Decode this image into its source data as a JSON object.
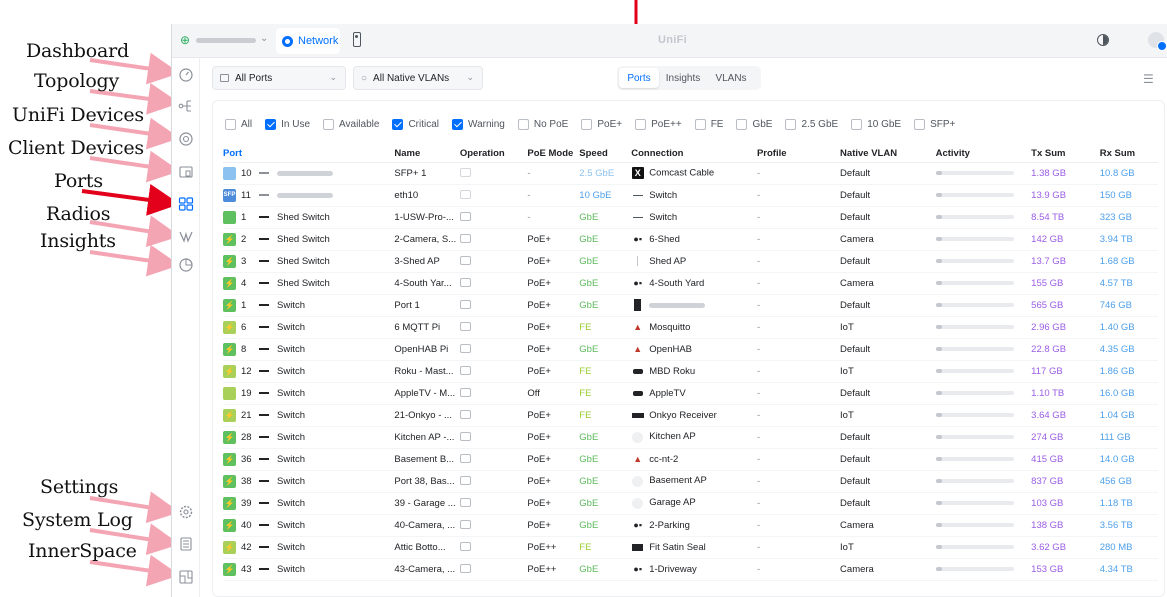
{
  "annotations": [
    {
      "label": "Dashboard"
    },
    {
      "label": "Topology"
    },
    {
      "label": "UniFi Devices"
    },
    {
      "label": "Client Devices"
    },
    {
      "label": "Ports"
    },
    {
      "label": "Radios"
    },
    {
      "label": "Insights"
    },
    {
      "label": "Settings"
    },
    {
      "label": "System Log"
    },
    {
      "label": "InnerSpace"
    }
  ],
  "colors": {
    "accent": "#006fff",
    "annotation_arrow": "#f4a5b4",
    "annotation_arrow_active": "#e3001b",
    "tx": "#9b5de5",
    "rx": "#4d9fea"
  },
  "topbar": {
    "app_tab": "Network",
    "brand": "UniFi"
  },
  "sidebar": {
    "items": [
      {
        "name": "dashboard",
        "icon": "speedometer-icon"
      },
      {
        "name": "topology",
        "icon": "topology-icon"
      },
      {
        "name": "unifi-devices",
        "icon": "device-icon"
      },
      {
        "name": "client-devices",
        "icon": "clients-icon"
      },
      {
        "name": "ports",
        "icon": "ports-icon",
        "active": true
      },
      {
        "name": "radios",
        "icon": "radio-icon"
      },
      {
        "name": "insights",
        "icon": "insights-icon"
      },
      {
        "name": "settings",
        "icon": "gear-icon"
      },
      {
        "name": "system-log",
        "icon": "log-icon"
      },
      {
        "name": "innerspace",
        "icon": "floorplan-icon"
      }
    ]
  },
  "filters": {
    "ports_select": "All Ports",
    "vlan_select": "All Native VLANs"
  },
  "view_tabs": [
    {
      "label": "Ports",
      "active": true
    },
    {
      "label": "Insights",
      "active": false
    },
    {
      "label": "VLANs",
      "active": false
    }
  ],
  "chips": [
    {
      "label": "All",
      "checked": false
    },
    {
      "label": "In Use",
      "checked": true
    },
    {
      "label": "Available",
      "checked": false
    },
    {
      "label": "Critical",
      "checked": true
    },
    {
      "label": "Warning",
      "checked": true
    },
    {
      "label": "No PoE",
      "checked": false
    },
    {
      "label": "PoE+",
      "checked": false
    },
    {
      "label": "PoE++",
      "checked": false
    },
    {
      "label": "FE",
      "checked": false
    },
    {
      "label": "GbE",
      "checked": false
    },
    {
      "label": "2.5 GbE",
      "checked": false
    },
    {
      "label": "10 GbE",
      "checked": false
    },
    {
      "label": "SFP+",
      "checked": false
    }
  ],
  "table": {
    "columns": [
      "Port",
      "Name",
      "Operation",
      "PoE Mode",
      "Speed",
      "Connection",
      "Profile",
      "Native VLAN",
      "Activity",
      "Tx Sum",
      "Rx Sum"
    ],
    "rows": [
      {
        "port": "10",
        "badge": "blue",
        "device": "",
        "name": "SFP+ 1",
        "poe": "-",
        "speed": "2.5 GbE",
        "speed_color": "gray",
        "conn_icon": "none",
        "connection": "Comcast Cable",
        "profile": "-",
        "vlan": "Default",
        "tx": "1.38 GB",
        "rx": "10.8 GB"
      },
      {
        "port": "11",
        "badge": "sfp",
        "device": "",
        "name": "eth10",
        "poe": "-",
        "speed": "10 GbE",
        "speed_color": "blue",
        "conn_icon": "dash",
        "connection": "Switch",
        "profile": "-",
        "vlan": "Default",
        "tx": "13.9 GB",
        "rx": "150 GB"
      },
      {
        "port": "1",
        "badge": "green-plain",
        "device": "Shed Switch",
        "name": "1-USW-Pro-...",
        "poe": "-",
        "speed": "GbE",
        "speed_color": "green",
        "conn_icon": "dash",
        "connection": "Switch",
        "profile": "-",
        "vlan": "Default",
        "tx": "8.54 TB",
        "rx": "323 GB"
      },
      {
        "port": "2",
        "badge": "green",
        "device": "Shed Switch",
        "name": "2-Camera, S...",
        "poe": "PoE+",
        "speed": "GbE",
        "speed_color": "green",
        "conn_icon": "camera",
        "connection": "6-Shed",
        "profile": "-",
        "vlan": "Camera",
        "tx": "142 GB",
        "rx": "3.94 TB"
      },
      {
        "port": "3",
        "badge": "green",
        "device": "Shed Switch",
        "name": "3-Shed AP",
        "poe": "PoE+",
        "speed": "GbE",
        "speed_color": "green",
        "conn_icon": "ap-bar",
        "connection": "Shed AP",
        "profile": "-",
        "vlan": "Default",
        "tx": "13.7 GB",
        "rx": "1.68 GB"
      },
      {
        "port": "4",
        "badge": "green",
        "device": "Shed Switch",
        "name": "4-South Yar...",
        "poe": "PoE+",
        "speed": "GbE",
        "speed_color": "green",
        "conn_icon": "camera",
        "connection": "4-South Yard",
        "profile": "-",
        "vlan": "Camera",
        "tx": "155 GB",
        "rx": "4.57 TB"
      },
      {
        "port": "1",
        "badge": "green",
        "device": "Switch",
        "name": "Port 1",
        "poe": "PoE+",
        "speed": "GbE",
        "speed_color": "green",
        "conn_icon": "tower",
        "connection": "",
        "profile": "-",
        "vlan": "Default",
        "tx": "565 GB",
        "rx": "746 GB"
      },
      {
        "port": "6",
        "badge": "lime",
        "device": "Switch",
        "name": "6 MQTT Pi",
        "poe": "PoE+",
        "speed": "FE",
        "speed_color": "lime",
        "conn_icon": "pi",
        "connection": "Mosquitto",
        "profile": "-",
        "vlan": "IoT",
        "tx": "2.96 GB",
        "rx": "1.40 GB"
      },
      {
        "port": "8",
        "badge": "green",
        "device": "Switch",
        "name": "OpenHAB Pi",
        "poe": "PoE+",
        "speed": "GbE",
        "speed_color": "green",
        "conn_icon": "pi",
        "connection": "OpenHAB",
        "profile": "-",
        "vlan": "Default",
        "tx": "22.8 GB",
        "rx": "4.35 GB"
      },
      {
        "port": "12",
        "badge": "lime",
        "device": "Switch",
        "name": "Roku - Mast...",
        "poe": "PoE+",
        "speed": "FE",
        "speed_color": "lime",
        "conn_icon": "box",
        "connection": "MBD Roku",
        "profile": "-",
        "vlan": "IoT",
        "tx": "117 GB",
        "rx": "1.86 GB"
      },
      {
        "port": "19",
        "badge": "lime-plain",
        "device": "Switch",
        "name": "AppleTV - M...",
        "poe": "Off",
        "speed": "FE",
        "speed_color": "lime",
        "conn_icon": "box",
        "connection": "AppleTV",
        "profile": "-",
        "vlan": "Default",
        "tx": "1.10 TB",
        "rx": "16.0 GB"
      },
      {
        "port": "21",
        "badge": "lime",
        "device": "Switch",
        "name": "21-Onkyo - ...",
        "poe": "PoE+",
        "speed": "FE",
        "speed_color": "lime",
        "conn_icon": "receiver",
        "connection": "Onkyo Receiver",
        "profile": "-",
        "vlan": "IoT",
        "tx": "3.64 GB",
        "rx": "1.04 GB"
      },
      {
        "port": "28",
        "badge": "green",
        "device": "Switch",
        "name": "Kitchen AP -...",
        "poe": "PoE+",
        "speed": "GbE",
        "speed_color": "green",
        "conn_icon": "ap",
        "connection": "Kitchen AP",
        "profile": "-",
        "vlan": "Default",
        "tx": "274 GB",
        "rx": "111 GB"
      },
      {
        "port": "36",
        "badge": "green",
        "device": "Switch",
        "name": "Basement B...",
        "poe": "PoE+",
        "speed": "GbE",
        "speed_color": "green",
        "conn_icon": "pi",
        "connection": "cc-nt-2",
        "profile": "-",
        "vlan": "Default",
        "tx": "415 GB",
        "rx": "14.0 GB"
      },
      {
        "port": "38",
        "badge": "green",
        "device": "Switch",
        "name": "Port 38, Bas...",
        "poe": "PoE+",
        "speed": "GbE",
        "speed_color": "green",
        "conn_icon": "ap",
        "connection": "Basement AP",
        "profile": "-",
        "vlan": "Default",
        "tx": "837 GB",
        "rx": "456 GB"
      },
      {
        "port": "39",
        "badge": "green",
        "device": "Switch",
        "name": "39 - Garage ...",
        "poe": "PoE+",
        "speed": "GbE",
        "speed_color": "green",
        "conn_icon": "ap",
        "connection": "Garage AP",
        "profile": "-",
        "vlan": "Default",
        "tx": "103 GB",
        "rx": "1.18 TB"
      },
      {
        "port": "40",
        "badge": "green",
        "device": "Switch",
        "name": "40-Camera, ...",
        "poe": "PoE+",
        "speed": "GbE",
        "speed_color": "green",
        "conn_icon": "camera",
        "connection": "2-Parking",
        "profile": "-",
        "vlan": "Camera",
        "tx": "138 GB",
        "rx": "3.56 TB"
      },
      {
        "port": "42",
        "badge": "lime",
        "device": "Switch",
        "name": "Attic Botto...",
        "poe": "PoE++",
        "speed": "FE",
        "speed_color": "lime",
        "conn_icon": "display",
        "connection": "Fit Satin Seal",
        "profile": "-",
        "vlan": "IoT",
        "tx": "3.62 GB",
        "rx": "280 MB"
      },
      {
        "port": "43",
        "badge": "green",
        "device": "Switch",
        "name": "43-Camera, ...",
        "poe": "PoE++",
        "speed": "GbE",
        "speed_color": "green",
        "conn_icon": "camera",
        "connection": "1-Driveway",
        "profile": "-",
        "vlan": "Camera",
        "tx": "153 GB",
        "rx": "4.34 TB"
      }
    ]
  }
}
